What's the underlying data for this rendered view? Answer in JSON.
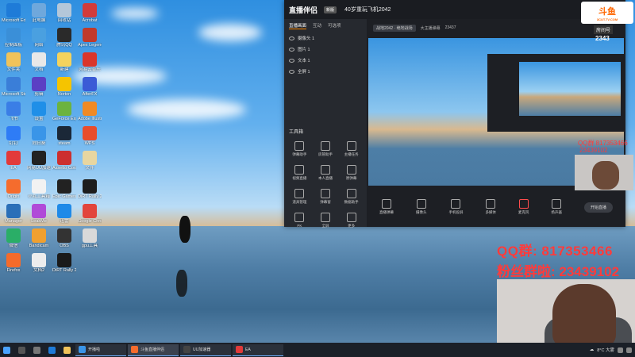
{
  "desktop": {
    "icons": [
      {
        "label": "Microsoft Edge",
        "color": "#1e7bd8"
      },
      {
        "label": "此电脑",
        "color": "#6fa8dc"
      },
      {
        "label": "回收站",
        "color": "#b4c7d9"
      },
      {
        "label": "Acrobat",
        "color": "#d23b3b"
      },
      {
        "label": "控制面板",
        "color": "#3a8fd8"
      },
      {
        "label": "网络",
        "color": "#4aa0e0"
      },
      {
        "label": "腾讯QQ",
        "color": "#2a2a2a"
      },
      {
        "label": "Apex Legends",
        "color": "#c13a2b"
      },
      {
        "label": "文件夹",
        "color": "#f0c35a"
      },
      {
        "label": "文档",
        "color": "#e8e8e8"
      },
      {
        "label": "新建",
        "color": "#f4d35e"
      },
      {
        "label": "网易云音乐",
        "color": "#d9352b"
      },
      {
        "label": "Microsoft Store",
        "color": "#3a7ed8"
      },
      {
        "label": "剪辑",
        "color": "#5b3fc4"
      },
      {
        "label": "Norton",
        "color": "#f5c400"
      },
      {
        "label": "AfterFX",
        "color": "#3b5bd6"
      },
      {
        "label": "飞书",
        "color": "#3a7ee6"
      },
      {
        "label": "设置",
        "color": "#1f8fe8"
      },
      {
        "label": "GeForce Experience",
        "color": "#6cb33f"
      },
      {
        "label": "Adobe Illustrator",
        "color": "#f08a24"
      },
      {
        "label": "钉钉",
        "color": "#2e7cf6"
      },
      {
        "label": "向日葵",
        "color": "#3a95e8"
      },
      {
        "label": "steam",
        "color": "#1b2838"
      },
      {
        "label": "WPS",
        "color": "#e94d2c"
      },
      {
        "label": "EA",
        "color": "#e23a3a"
      },
      {
        "label": "网易UU加速器",
        "color": "#222"
      },
      {
        "label": "Assetto Corsa",
        "color": "#cc2f2f"
      },
      {
        "label": "文件",
        "color": "#e8d6a0"
      },
      {
        "label": "Origin",
        "color": "#f56c2d"
      },
      {
        "label": "小丸工具箱",
        "color": "#f2f2f2"
      },
      {
        "label": "Epic Games",
        "color": "#222"
      },
      {
        "label": "DiRT Rally 2.0",
        "color": "#1d1d1d"
      },
      {
        "label": "Manager",
        "color": "#2a6fb8"
      },
      {
        "label": "LeakMe",
        "color": "#b04ad8"
      },
      {
        "label": "迅雷",
        "color": "#1f8ae8"
      },
      {
        "label": "Google Chrome",
        "color": "#e2453c"
      },
      {
        "label": "微信",
        "color": "#2aae67"
      },
      {
        "label": "Bandicam",
        "color": "#f0a030"
      },
      {
        "label": "OBS",
        "color": "#333"
      },
      {
        "label": "gpu工具",
        "color": "#d9d9d9"
      },
      {
        "label": "Firefox",
        "color": "#f56b2b"
      },
      {
        "label": "文档2",
        "color": "#ededed"
      },
      {
        "label": "DiRT Rally 2",
        "color": "#1a1a1a"
      }
    ]
  },
  "app": {
    "logo": "直播伴侣",
    "badge": "新版",
    "stream_title": "40岁重玩飞机2042",
    "tabs": [
      "直播画面",
      "互动",
      "可选项"
    ],
    "layers": [
      "摄像头 1",
      "图片 1",
      "文本 1",
      "全屏 1"
    ],
    "tools_title": "工具箱",
    "tools": [
      "弹幕助手",
      "房管助手",
      "主播任务",
      "视频直播",
      "本人直播",
      "原弹幕",
      "道具管理",
      "弹幕窗",
      "数据助手",
      "PK",
      "全屏",
      "更多"
    ],
    "preview_meta": [
      "战地2042 · 绝地战场",
      "大主播弹幕",
      "23437"
    ],
    "bottom": [
      "直播弹幕",
      "摄像头",
      "手机投屏",
      "多媒体",
      "麦克风",
      "扬声器"
    ],
    "start_button": "开始直播"
  },
  "overlay": {
    "douyu_logo": "斗鱼",
    "douyu_site": "3CUT.TV.COM",
    "room_label": "房间号",
    "room_number": "2343",
    "qq_group": "QQ群: 817353466",
    "fans_group": "粉丝群啦: 23439102",
    "small_red_1": "QQ群 817353466",
    "small_red_2": "23439102"
  },
  "taskbar": {
    "apps": [
      "开播啦",
      "斗鱼直播伴侣",
      "UU加速器",
      "EA"
    ],
    "weather": "8°C 大雾",
    "time": "",
    "colors": {
      "accent": "#6fb1ff"
    }
  }
}
